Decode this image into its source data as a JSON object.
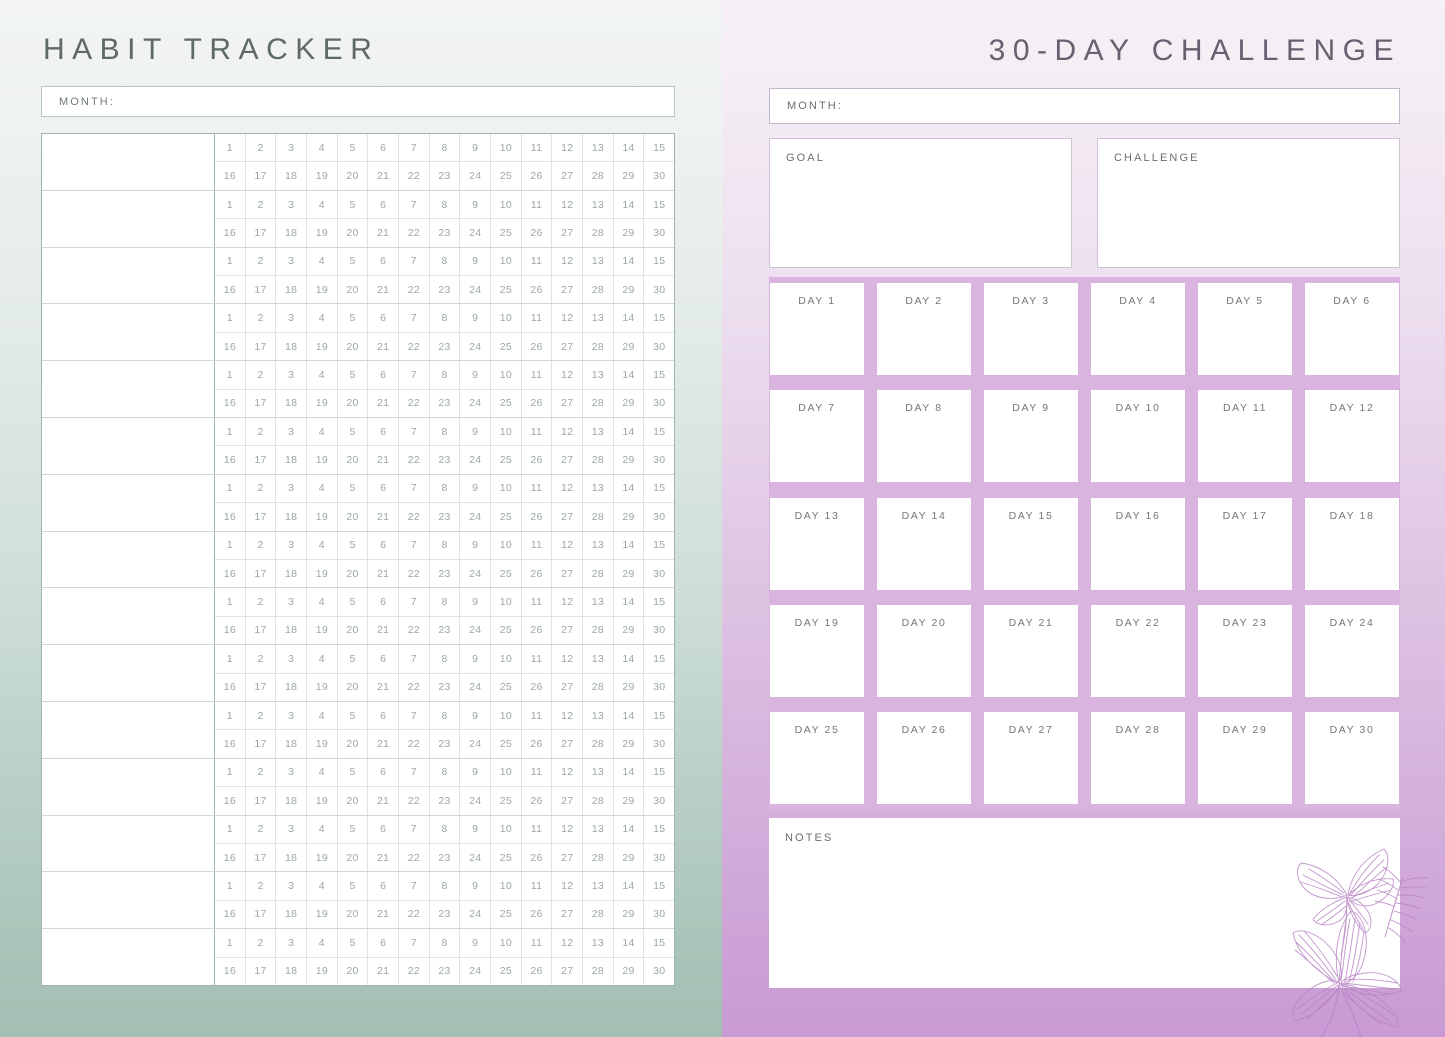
{
  "left": {
    "title": "HABIT TRACKER",
    "month_label": "MONTH:",
    "habit_rows": 15,
    "day_numbers_top": [
      "1",
      "2",
      "3",
      "4",
      "5",
      "6",
      "7",
      "8",
      "9",
      "10",
      "11",
      "12",
      "13",
      "14",
      "15"
    ],
    "day_numbers_bottom": [
      "16",
      "17",
      "18",
      "19",
      "20",
      "21",
      "22",
      "23",
      "24",
      "25",
      "26",
      "27",
      "28",
      "29",
      "30"
    ],
    "colors": {
      "background_top": "#f1f4f2",
      "background_bottom": "#a3beb2",
      "table_border": "#9fb5ad",
      "grid_line": "#dde3e1",
      "text": "#5d6a66",
      "number_text": "#9aa8a4"
    }
  },
  "right": {
    "title": "30-DAY CHALLENGE",
    "month_label": "MONTH:",
    "goal_label": "GOAL",
    "challenge_label": "CHALLENGE",
    "notes_label": "NOTES",
    "day_rows": [
      [
        "DAY 1",
        "DAY 2",
        "DAY 3",
        "DAY 4",
        "DAY 5",
        "DAY 6"
      ],
      [
        "DAY 7",
        "DAY 8",
        "DAY 9",
        "DAY 10",
        "DAY 11",
        "DAY 12"
      ],
      [
        "DAY 13",
        "DAY 14",
        "DAY 15",
        "DAY 16",
        "DAY 17",
        "DAY 18"
      ],
      [
        "DAY 19",
        "DAY 20",
        "DAY 21",
        "DAY 22",
        "DAY 23",
        "DAY 24"
      ],
      [
        "DAY 25",
        "DAY 26",
        "DAY 27",
        "DAY 28",
        "DAY 29",
        "DAY 30"
      ]
    ],
    "decoration": "floral-illustration",
    "colors": {
      "background_top": "#f6f1f6",
      "background_bottom": "#c99ad4",
      "panel": "#d8b4de",
      "card": "#ffffff",
      "text": "#6a5f70",
      "label_text": "#78737d",
      "floral_stroke": "#b884c4"
    }
  }
}
